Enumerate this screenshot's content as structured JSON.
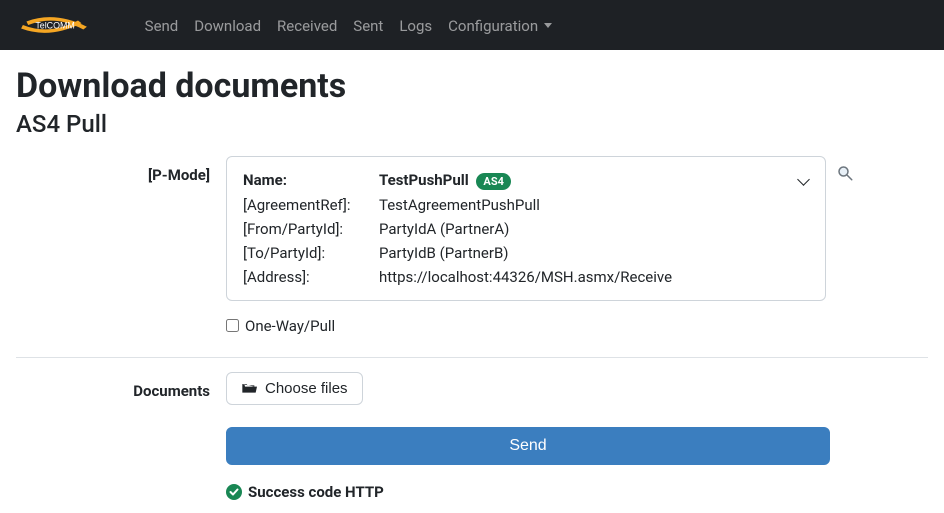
{
  "nav": {
    "items": [
      {
        "label": "Send"
      },
      {
        "label": "Download"
      },
      {
        "label": "Received"
      },
      {
        "label": "Sent"
      },
      {
        "label": "Logs"
      },
      {
        "label": "Configuration",
        "dropdown": true
      }
    ]
  },
  "page": {
    "title": "Download documents",
    "subtitle": "AS4 Pull"
  },
  "form": {
    "pmode": {
      "label": "[P-Mode]",
      "name_label": "Name:",
      "name_value": "TestPushPull",
      "badge": "AS4",
      "rows": [
        {
          "label": "[AgreementRef]:",
          "value": "TestAgreementPushPull"
        },
        {
          "label": "[From/PartyId]:",
          "value": "PartyIdA (PartnerA)"
        },
        {
          "label": "[To/PartyId]:",
          "value": "PartyIdB (PartnerB)"
        },
        {
          "label": "[Address]:",
          "value": "https://localhost:44326/MSH.asmx/Receive"
        }
      ]
    },
    "oneway": {
      "label": "One-Way/Pull"
    },
    "documents": {
      "label": "Documents",
      "choose_label": "Choose files"
    },
    "send_label": "Send"
  },
  "status": {
    "text": "Success code HTTP"
  }
}
